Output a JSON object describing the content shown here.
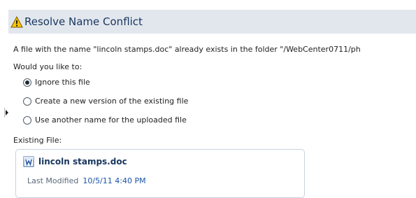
{
  "dialog": {
    "title": "Resolve Name Conflict",
    "message": "A file with the name \"lincoln stamps.doc\" already exists in the folder \"/WebCenter0711/ph",
    "prompt": "Would you like to:",
    "options": [
      {
        "label": "Ignore this file",
        "selected": true
      },
      {
        "label": "Create a new version of the existing file",
        "selected": false
      },
      {
        "label": "Use another name for the uploaded file",
        "selected": false
      }
    ],
    "existing_label": "Existing File:",
    "existing_file": {
      "name": "lincoln stamps.doc",
      "modified_label": "Last Modified",
      "modified_value": "10/5/11 4:40 PM"
    }
  },
  "icons": {
    "header_icon": "warning-icon",
    "file_icon": "word-doc-icon",
    "side_handle_icon": "expand-arrow-icon"
  },
  "colors": {
    "header_bg": "#e2e7ee",
    "title_color": "#17365d",
    "link_color": "#1a55a5",
    "warning_yellow": "#f7c600"
  }
}
